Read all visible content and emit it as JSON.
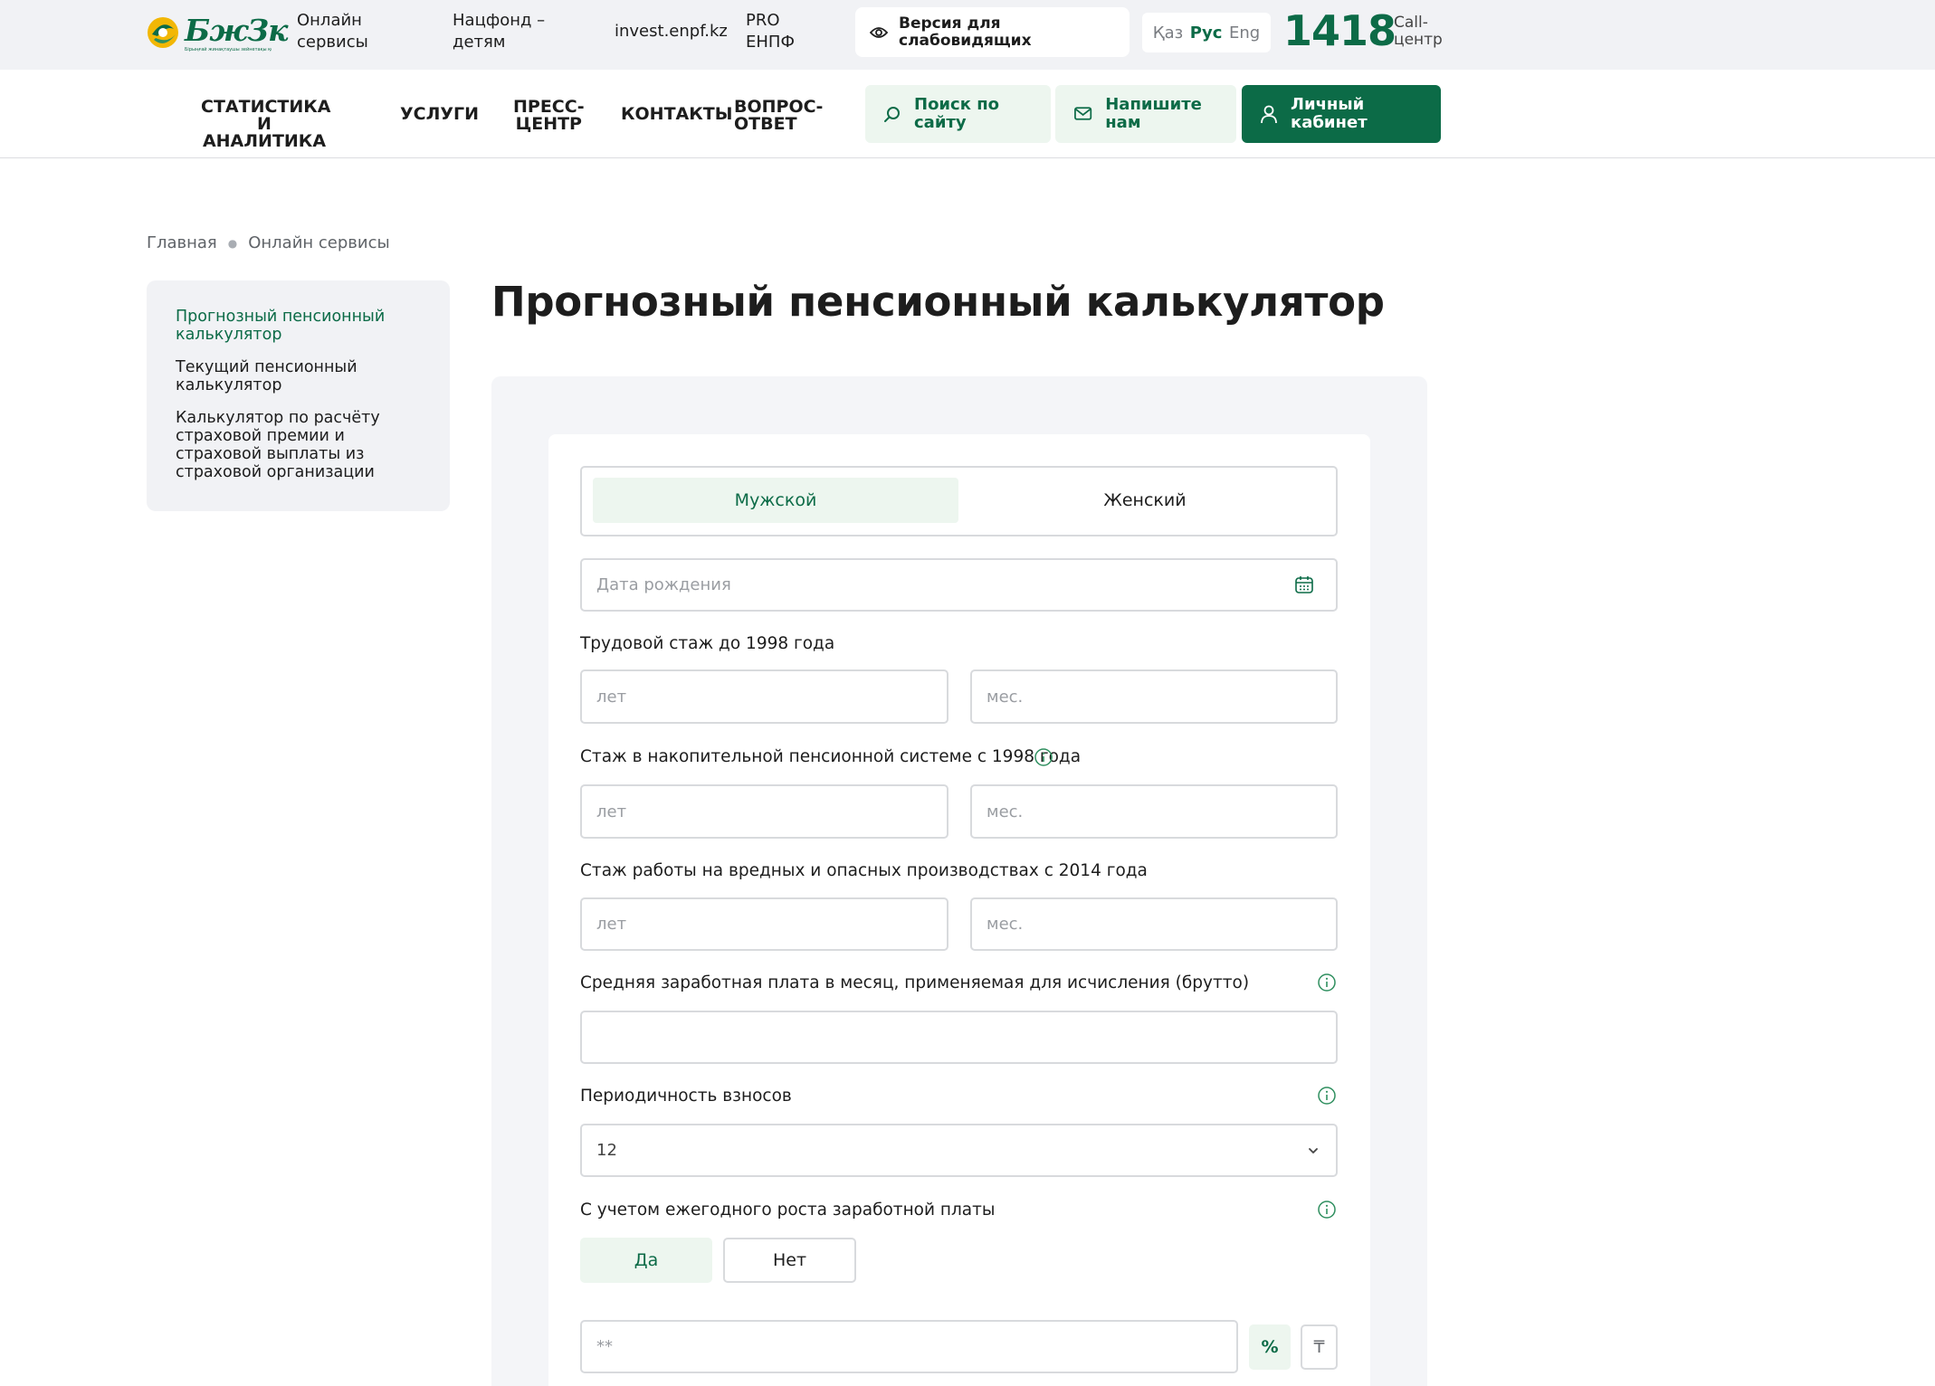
{
  "header": {
    "logo_text": "БжЗк",
    "logo_subtext": "Бірыңғай жинақтаушы зейнетақы қоры",
    "links": [
      {
        "label_line1": "Онлайн",
        "label_line2": "сервисы"
      },
      {
        "label_line1": "Нацфонд –",
        "label_line2": "детям"
      },
      {
        "label_line1": "invest.enpf.kz",
        "label_line2": ""
      },
      {
        "label_line1": "PRO",
        "label_line2": "ЕНПФ"
      }
    ],
    "vision_line1": "Версия для",
    "vision_line2": "слабовидящих",
    "languages": [
      "Қаз",
      "Рус",
      "Eng"
    ],
    "active_language": "Рус",
    "call_number": "1418",
    "call_label_line1": "Call-",
    "call_label_line2": "центр"
  },
  "nav": {
    "items": [
      {
        "line1": "Статистика и",
        "line2": "аналитика"
      },
      {
        "line1": "Услуги",
        "line2": ""
      },
      {
        "line1": "Пресс-",
        "line2": "центр"
      },
      {
        "line1": "Контакты",
        "line2": ""
      },
      {
        "line1": "Вопрос-",
        "line2": "ответ"
      }
    ],
    "search_line1": "Поиск по",
    "search_line2": "сайту",
    "write_line1": "Напишите",
    "write_line2": "нам",
    "cabinet_line1": "Личный",
    "cabinet_line2": "кабинет"
  },
  "breadcrumb": [
    "Главная",
    "Онлайн сервисы"
  ],
  "sidebar": {
    "items": [
      {
        "label": "Прогнозный пенсионный калькулятор",
        "active": true
      },
      {
        "label": "Текущий пенсионный калькулятор",
        "active": false
      },
      {
        "label": "Калькулятор по расчёту страховой премии и страховой выплаты из страховой организации",
        "active": false
      }
    ]
  },
  "page_title": "Прогнозный пенсионный калькулятор",
  "form": {
    "gender_options": [
      "Мужской",
      "Женский"
    ],
    "gender_selected": "Мужской",
    "birth_date_placeholder": "Дата рождения",
    "work_before_1998_label": "Трудовой стаж до 1998 года",
    "accum_since_1998_label": "Стаж в накопительной пенсионной системе с 1998 года",
    "hazard_since_2014_label": "Стаж работы на вредных и опасных производствах с 2014 года",
    "years_placeholder": "лет",
    "months_placeholder": "мес.",
    "salary_label": "Средняя заработная плата в месяц, применяемая для исчисления (брутто)",
    "salary_value": "",
    "periodicity_label": "Периодичность взносов",
    "periodicity_value": "12",
    "growth_label": "С учетом ежегодного роста заработной платы",
    "growth_options": [
      "Да",
      "Нет"
    ],
    "growth_selected": "Да",
    "growth_placeholder": "**",
    "unit_percent": "%",
    "unit_tenge": "₸"
  },
  "colors": {
    "brand_green": "#0c6b47",
    "light_green": "#edf6ef",
    "topbar_bg": "#f1f2f5",
    "panel_bg": "#f4f5f8",
    "border": "#d8dadd"
  }
}
